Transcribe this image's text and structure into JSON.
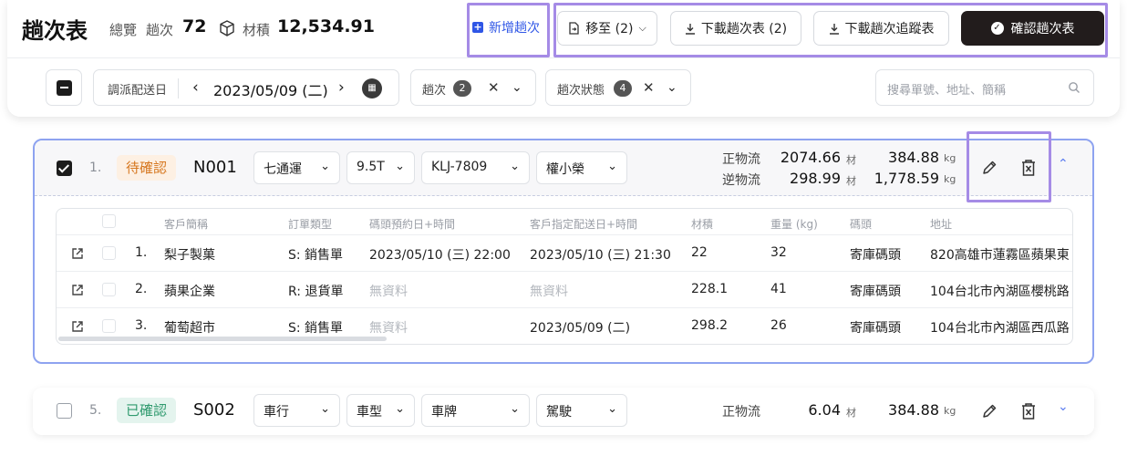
{
  "header": {
    "title": "趟次表",
    "overview_label": "總覽",
    "trips_label": "趟次",
    "trips_count": "72",
    "volume_label": "材積",
    "volume_value": "12,534.91",
    "add_trip": "新增趟次",
    "move_to": "移至 (2)",
    "download_trips": "下載趟次表 (2)",
    "download_tracking": "下載趟次追蹤表",
    "confirm": "確認趟次表"
  },
  "filters": {
    "dispatch_date_label": "調派配送日",
    "date": "2023/05/09 (二)",
    "trip_label": "趟次",
    "trip_count": "2",
    "status_label": "趟次狀態",
    "status_count": "4",
    "search_placeholder": "搜尋單號、地址、簡稱"
  },
  "trips": [
    {
      "index": "1.",
      "status": "待確認",
      "trip_no": "N001",
      "carrier": "七通運",
      "truck_type": "9.5T",
      "plate": "KLJ-7809",
      "driver": "權小榮",
      "forward_label": "正物流",
      "forward_volume": "2074.66",
      "forward_weight": "384.88",
      "reverse_label": "逆物流",
      "reverse_volume": "298.99",
      "reverse_weight": "1,778.59",
      "unit_volume": "材",
      "unit_weight": "kg",
      "columns": [
        "客戶簡稱",
        "訂單類型",
        "碼頭預約日+時間",
        "客戶指定配送日+時間",
        "材積",
        "重量 (kg)",
        "碼頭",
        "地址"
      ],
      "rows": [
        {
          "no": "1.",
          "customer": "梨子製菓",
          "order_type": "S: 銷售單",
          "dock_time": "2023/05/10 (三) 22:00",
          "deliver_time": "2023/05/10 (三) 21:30",
          "volume": "22",
          "weight": "32",
          "dock": "寄庫碼頭",
          "address": "820高雄市蓮霧區蘋果東"
        },
        {
          "no": "2.",
          "customer": "蘋果企業",
          "order_type": "R: 退貨單",
          "dock_time": "無資料",
          "deliver_time": "無資料",
          "volume": "228.1",
          "weight": "41",
          "dock": "寄庫碼頭",
          "address": "104台北市內湖區櫻桃路"
        },
        {
          "no": "3.",
          "customer": "葡萄超市",
          "order_type": "S: 銷售單",
          "dock_time": "無資料",
          "deliver_time": "2023/05/09 (二)",
          "volume": "298.2",
          "weight": "26",
          "dock": "寄庫碼頭",
          "address": "104台北市內湖區西瓜路"
        }
      ]
    },
    {
      "index": "5.",
      "status": "已確認",
      "trip_no": "S002",
      "carrier": "車行",
      "truck_type": "車型",
      "plate": "車牌",
      "driver": "駕駛",
      "forward_label": "正物流",
      "forward_volume": "6.04",
      "forward_weight": "384.88",
      "unit_volume": "材",
      "unit_weight": "kg"
    }
  ],
  "icons": {
    "chevron_down": "chevron-down-icon",
    "chevron_up": "chevron-up-icon",
    "edit": "pencil-icon",
    "delete": "delete-x-icon",
    "calendar": "calendar-icon",
    "search": "search-icon",
    "external_link": "external-link-icon",
    "box": "box-icon",
    "download": "download-icon"
  },
  "colors": {
    "accent_blue": "#2f56e6",
    "highlight_purple": "#a58be6",
    "selected_border": "#8ea3f0",
    "pending_text": "#d6771f",
    "confirmed_text": "#2f9a6e",
    "primary_dark": "#221c1c"
  }
}
